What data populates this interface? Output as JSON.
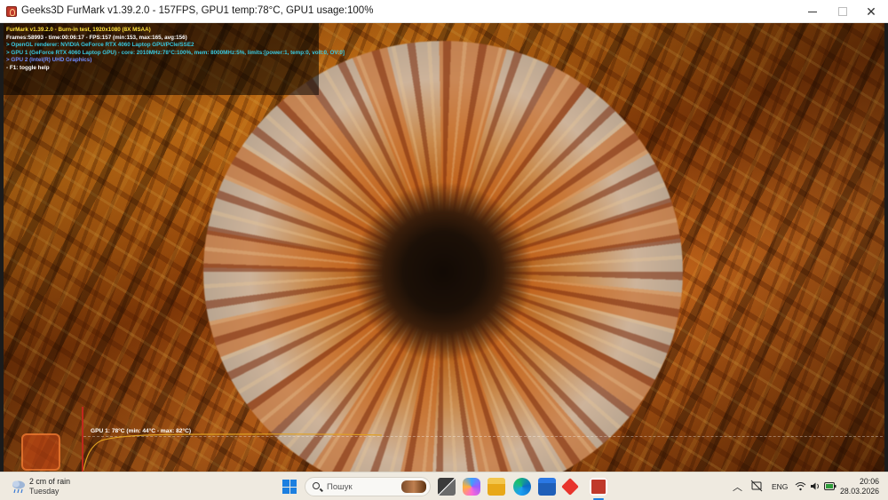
{
  "window": {
    "title": "Geeks3D FurMark v1.39.2.0 - 157FPS, GPU1 temp:78°C, GPU1 usage:100%",
    "controls": [
      "minimize",
      "maximize",
      "close"
    ]
  },
  "osd": {
    "lines": [
      "FurMark v1.39.2.0 - Burn-in test, 1920x1080 (8X MSAA)",
      "Frames:58993 - time:00:06:17 - FPS:157 (min:153, max:165, avg:156)",
      "> OpenGL renderer: NVIDIA GeForce RTX 4060 Laptop GPU/PCIe/SSE2",
      "> GPU 1 (GeForce RTX 4060 Laptop GPU) - core: 2010MHz:78°C:100%, mem: 8000MHz:5%, limits:[power:1, temp:0, volt:0, OV:0]",
      "> GPU 2 (Intel(R) UHD Graphics)",
      "- F1: toggle help"
    ],
    "line_colors": [
      "#ffe23a",
      "#ffffff",
      "#38c8e0",
      "#38c8e0",
      "#6f8cff",
      "#ffffff"
    ]
  },
  "graph": {
    "label": "GPU 1: 78°C (min: 44°C - max: 82°C)",
    "line_color": "#e0a020",
    "axis_color": "#c0281c"
  },
  "taskbar": {
    "weather": {
      "main": "2 cm of rain",
      "sub": "Tuesday",
      "icon": "rain-cloud-icon"
    },
    "search": {
      "placeholder": "Пошук"
    },
    "apps": [
      "task-view",
      "copilot",
      "file-explorer",
      "edge",
      "microsoft-store",
      "anydesk",
      "furmark"
    ],
    "active_app": "furmark",
    "tray": {
      "language": "ENG"
    },
    "clock": {
      "time": "20:06",
      "date": "28.03.2026"
    }
  },
  "colors": {
    "accent": "#1c7fe0",
    "furmark_red": "#c0392b"
  }
}
